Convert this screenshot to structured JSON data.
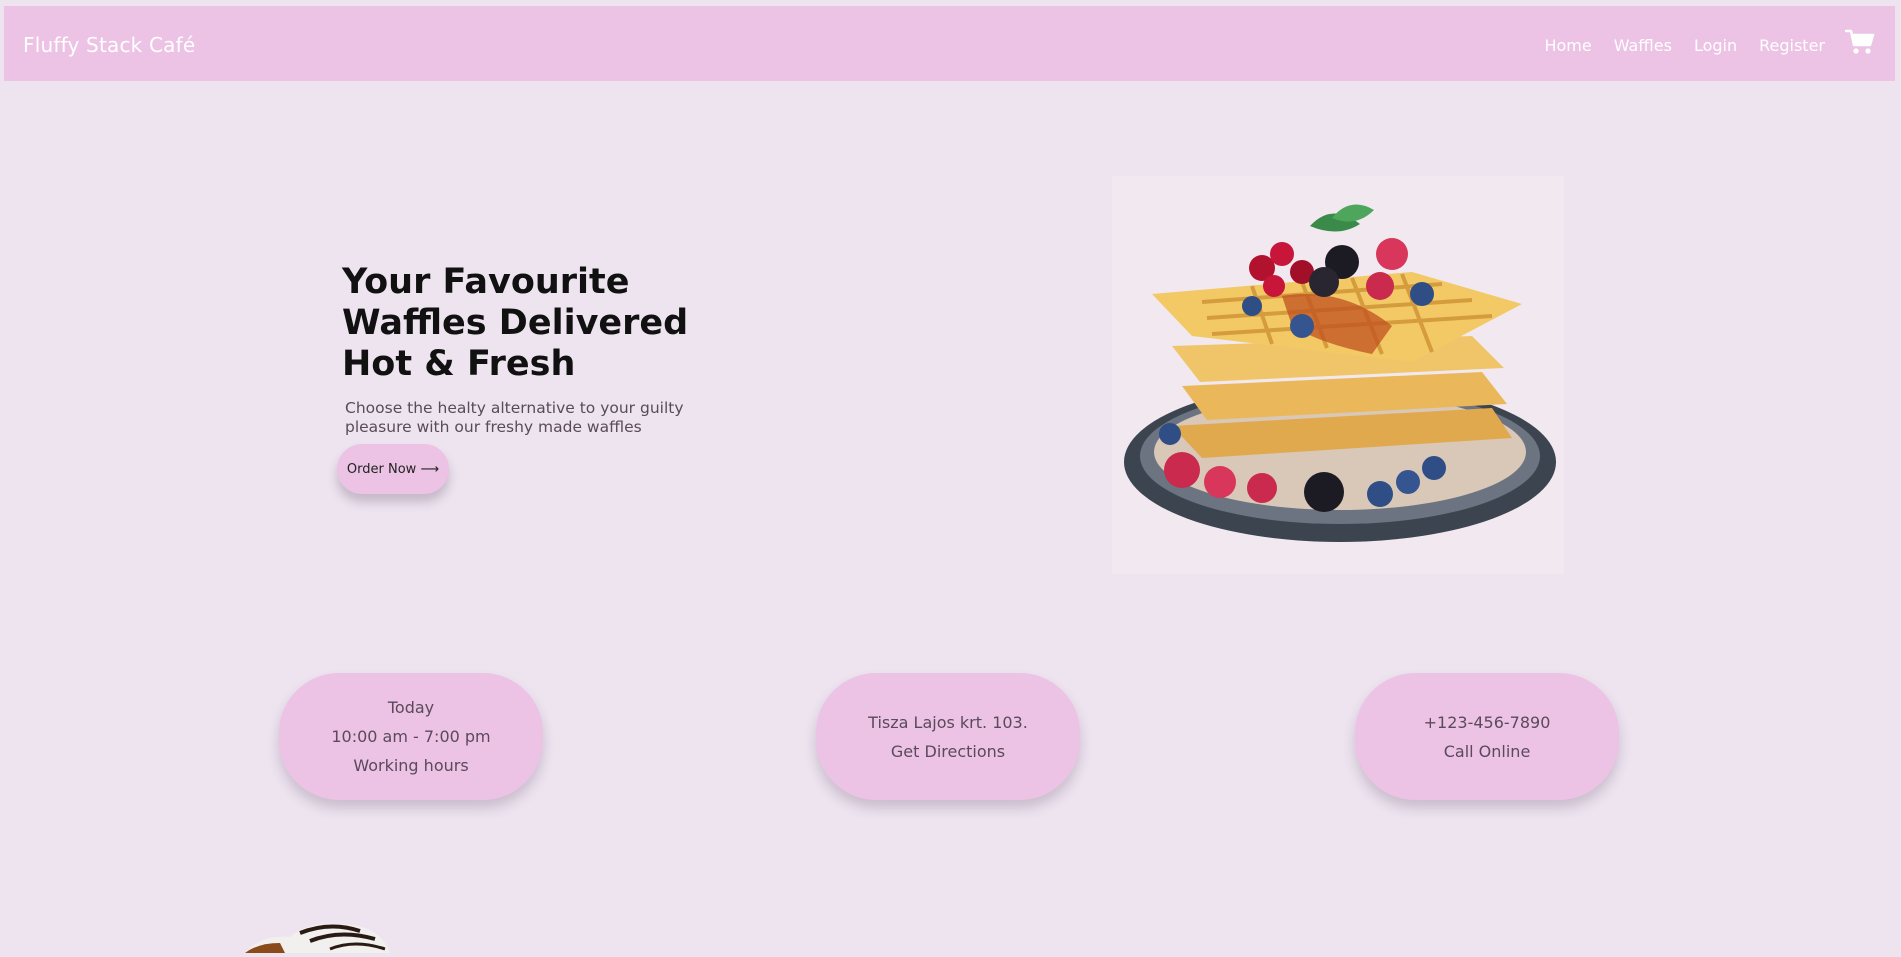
{
  "navbar": {
    "brand": "Fluffy Stack Café",
    "links": [
      "Home",
      "Waffles",
      "Login",
      "Register"
    ],
    "cart_icon": "cart-icon"
  },
  "hero": {
    "title": "Your Favourite Waffles Delivered Hot & Fresh",
    "subtitle": "Choose the healty alternative to your guilty pleasure with our freshy made waffles",
    "order_button": "Order Now ⟶"
  },
  "info_cards": {
    "hours": {
      "day": "Today",
      "time": "10:00 am - 7:00 pm",
      "label": "Working hours"
    },
    "address": {
      "street": "Tisza Lajos krt. 103.",
      "label": "Get Directions"
    },
    "phone": {
      "number": "+123-456-7890",
      "label": "Call Online"
    }
  },
  "colors": {
    "background": "#ede4f0",
    "accent": "#ecc3e5",
    "text": "#5a4a5a"
  }
}
